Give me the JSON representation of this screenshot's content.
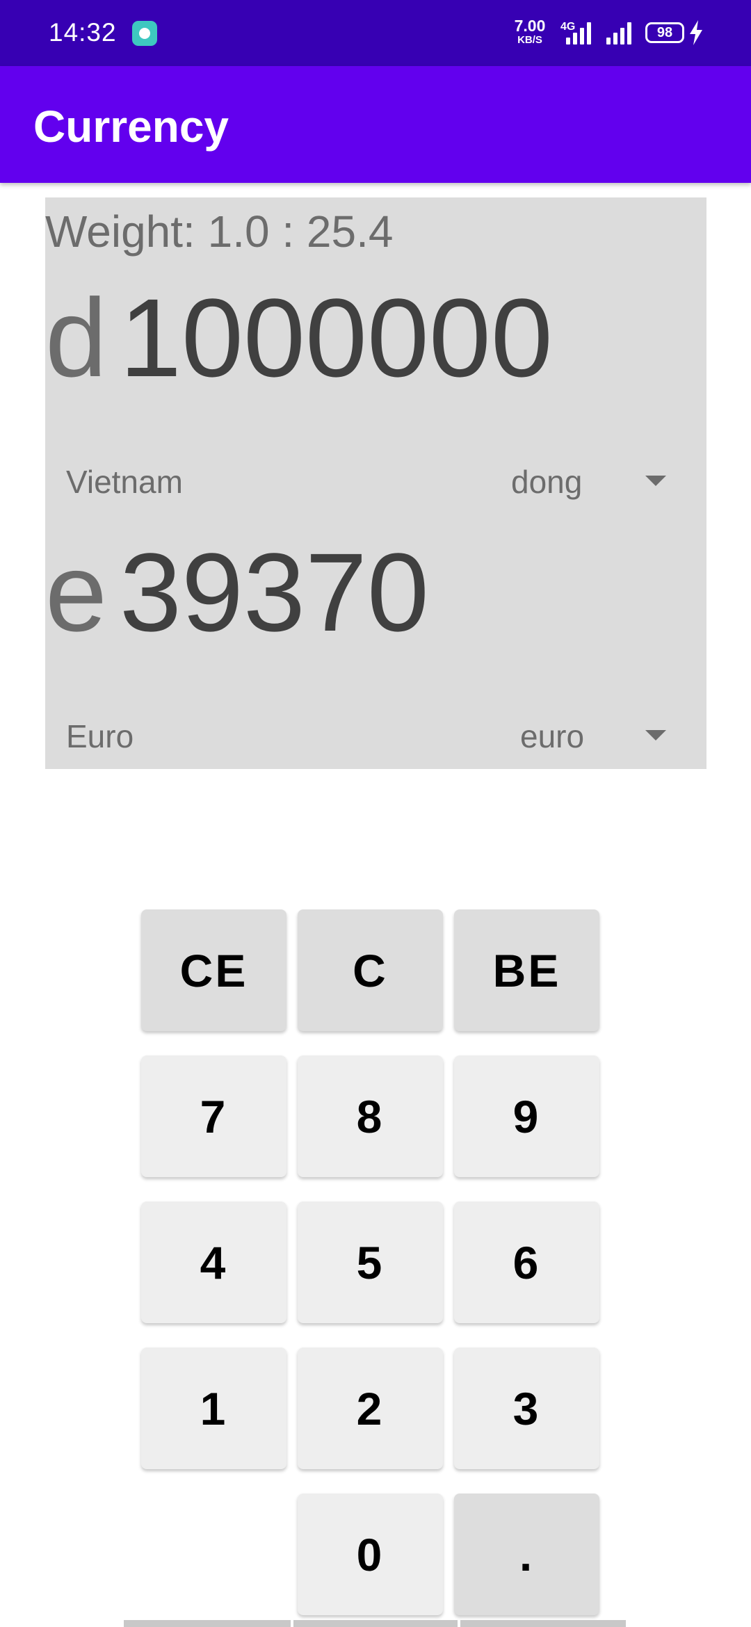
{
  "status_bar": {
    "time": "14:32",
    "net_speed_value": "7.00",
    "net_speed_unit": "KB/S",
    "network_type": "4G",
    "battery_level": "98",
    "icons": [
      "app-notification-icon",
      "signal-icon",
      "battery-icon",
      "charging-icon"
    ],
    "color": "#3700b3"
  },
  "app_bar": {
    "title": "Currency",
    "color": "#6200ee"
  },
  "converter": {
    "weight_text": "Weight: 1.0 : 25.4",
    "from": {
      "symbol": "d",
      "amount": "1000000",
      "country": "Vietnam",
      "currency": "dong"
    },
    "to": {
      "symbol": "e",
      "amount": "39370",
      "country": "Euro",
      "currency": "euro"
    }
  },
  "keypad": {
    "keys": [
      [
        "CE",
        "C",
        "BE"
      ],
      [
        "7",
        "8",
        "9"
      ],
      [
        "4",
        "5",
        "6"
      ],
      [
        "1",
        "2",
        "3"
      ],
      [
        "",
        "0",
        "."
      ]
    ]
  }
}
